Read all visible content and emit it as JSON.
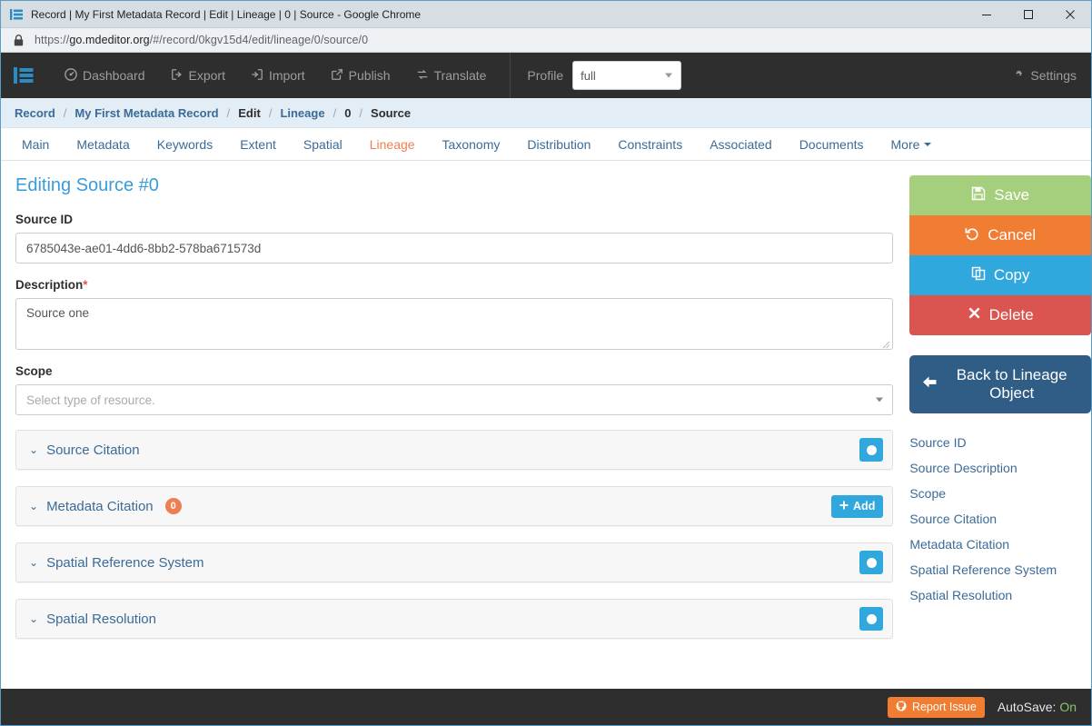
{
  "browser": {
    "tab_title": "Record | My First Metadata Record | Edit | Lineage | 0 | Source - Google Chrome",
    "url_scheme": "https://",
    "url_domain": "go.mdeditor.org",
    "url_path": "/#/record/0kgv15d4/edit/lineage/0/source/0",
    "minimize": "—",
    "maximize": "□",
    "close": "✕"
  },
  "navbar": {
    "brand_icon": "mdeditor-logo-icon",
    "items": [
      {
        "label": "Dashboard",
        "icon": "dashboard-icon"
      },
      {
        "label": "Export",
        "icon": "export-icon"
      },
      {
        "label": "Import",
        "icon": "import-icon"
      },
      {
        "label": "Publish",
        "icon": "publish-icon"
      },
      {
        "label": "Translate",
        "icon": "translate-icon"
      }
    ],
    "profile_label": "Profile",
    "profile_value": "full",
    "settings_label": "Settings"
  },
  "breadcrumb": [
    {
      "label": "Record",
      "link": true
    },
    {
      "label": "My First Metadata Record",
      "link": true
    },
    {
      "label": "Edit",
      "link": false
    },
    {
      "label": "Lineage",
      "link": true
    },
    {
      "label": "0",
      "link": false
    },
    {
      "label": "Source",
      "link": false
    }
  ],
  "breadcrumb_separator": "/",
  "tabs": [
    {
      "label": "Main",
      "active": false
    },
    {
      "label": "Metadata",
      "active": false
    },
    {
      "label": "Keywords",
      "active": false
    },
    {
      "label": "Extent",
      "active": false
    },
    {
      "label": "Spatial",
      "active": false
    },
    {
      "label": "Lineage",
      "active": true
    },
    {
      "label": "Taxonomy",
      "active": false
    },
    {
      "label": "Distribution",
      "active": false
    },
    {
      "label": "Constraints",
      "active": false
    },
    {
      "label": "Associated",
      "active": false
    },
    {
      "label": "Documents",
      "active": false
    },
    {
      "label": "More",
      "active": false,
      "dropdown": true
    }
  ],
  "main": {
    "page_title": "Editing Source #0",
    "source_id": {
      "label": "Source ID",
      "value": "6785043e-ae01-4dd6-8bb2-578ba671573d"
    },
    "description": {
      "label": "Description",
      "required_marker": "*",
      "value": "Source one"
    },
    "scope": {
      "label": "Scope",
      "placeholder": "Select type of resource."
    },
    "panels": [
      {
        "title": "Source Citation",
        "chevron": "⌄",
        "control": "dot",
        "badge": null
      },
      {
        "title": "Metadata Citation",
        "chevron": "⌄",
        "control": "add",
        "badge": "0",
        "add_label": "Add"
      },
      {
        "title": "Spatial Reference System",
        "chevron": "⌄",
        "control": "dot",
        "badge": null
      },
      {
        "title": "Spatial Resolution",
        "chevron": "⌄",
        "control": "dot",
        "badge": null
      }
    ]
  },
  "sidebar": {
    "actions": [
      {
        "label": "Save",
        "icon": "floppy-disk-icon",
        "color": "#a5cf7c"
      },
      {
        "label": "Cancel",
        "icon": "undo-icon",
        "color": "#f07d32"
      },
      {
        "label": "Copy",
        "icon": "copy-icon",
        "color": "#31a8dd"
      },
      {
        "label": "Delete",
        "icon": "x-mark-icon",
        "color": "#dc5450"
      }
    ],
    "back_button": {
      "label": "Back to Lineage Object",
      "icon": "arrow-left-icon",
      "color": "#2f5d86"
    },
    "links": [
      "Source ID",
      "Source Description",
      "Scope",
      "Source Citation",
      "Metadata Citation",
      "Spatial Reference System",
      "Spatial Resolution"
    ]
  },
  "footer": {
    "report_label": "Report Issue",
    "report_icon": "github-icon",
    "autosave_label": "AutoSave:",
    "autosave_value": "On"
  }
}
